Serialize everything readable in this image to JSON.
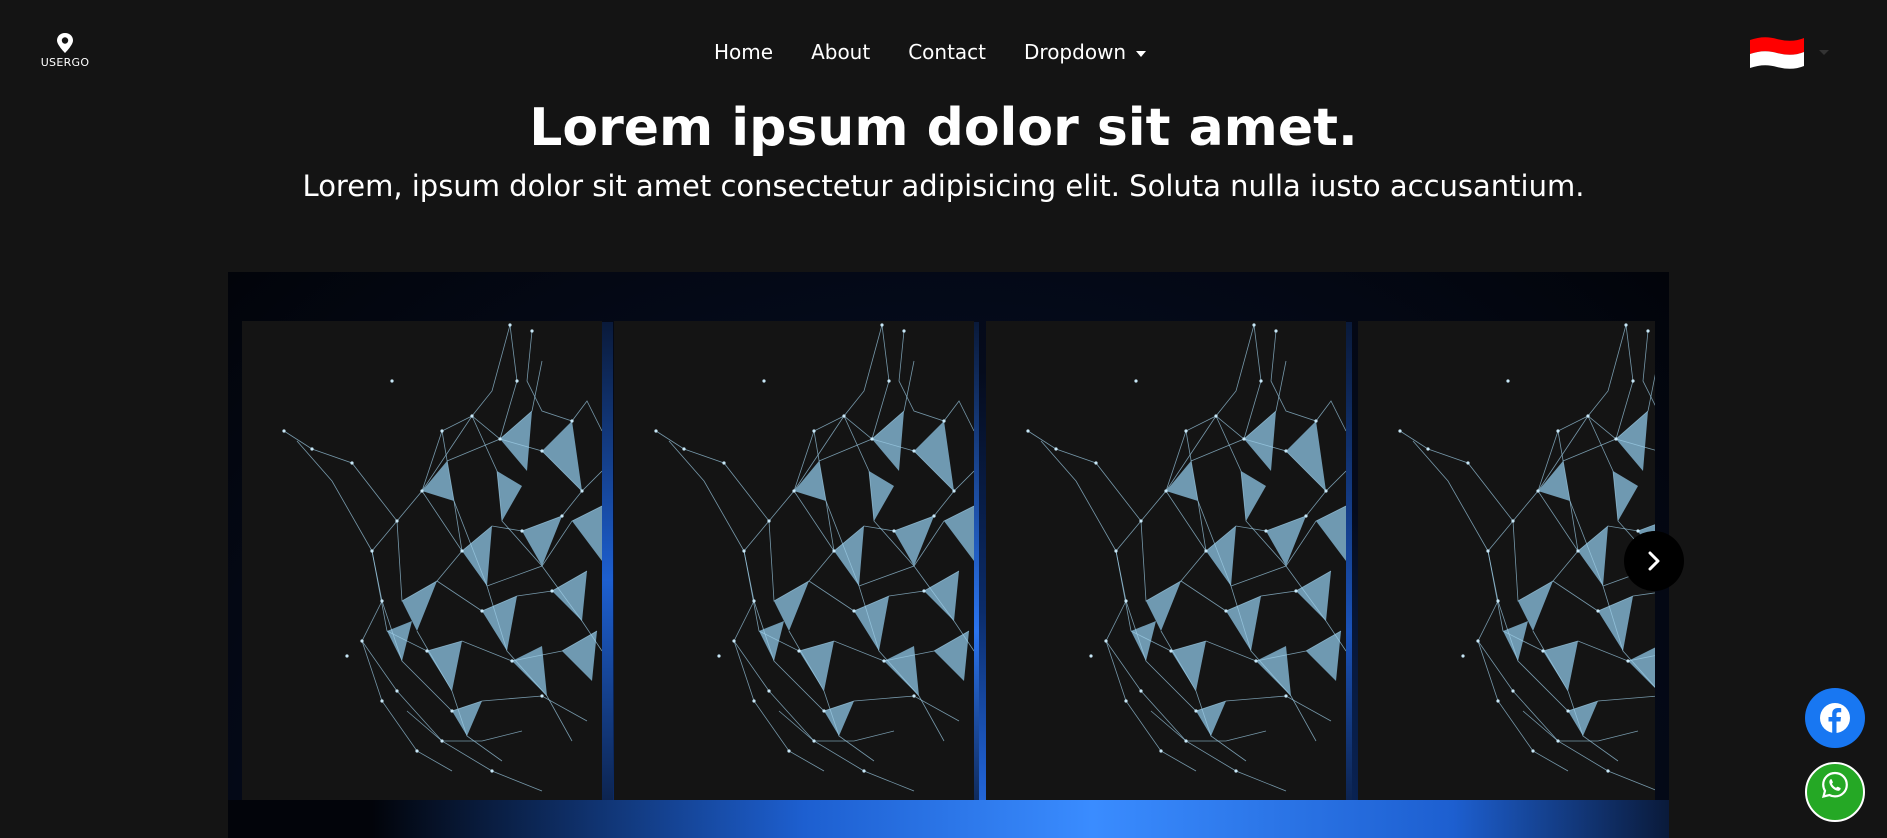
{
  "brand": {
    "logo_text": "USERGO"
  },
  "nav": {
    "items": [
      {
        "label": "Home"
      },
      {
        "label": "About"
      },
      {
        "label": "Contact"
      },
      {
        "label": "Dropdown"
      }
    ]
  },
  "language": {
    "flag": "indonesia-flag",
    "colors": [
      "#ff0000",
      "#ffffff"
    ]
  },
  "hero": {
    "title": "Lorem ipsum dolor sit amet.",
    "subtitle": "Lorem, ipsum dolor sit amet consectetur adipisicing elit. Soluta nulla iusto accusantium."
  },
  "carousel": {
    "slide_image": "network-mesh-image",
    "next_icon": "chevron-right-icon"
  },
  "social": {
    "facebook_icon": "facebook-icon",
    "whatsapp_icon": "whatsapp-icon",
    "facebook_color": "#1877f2",
    "whatsapp_color": "#25a825"
  },
  "colors": {
    "background": "#141414",
    "text": "#ffffff",
    "accent_blue": "#1d5fd0"
  }
}
